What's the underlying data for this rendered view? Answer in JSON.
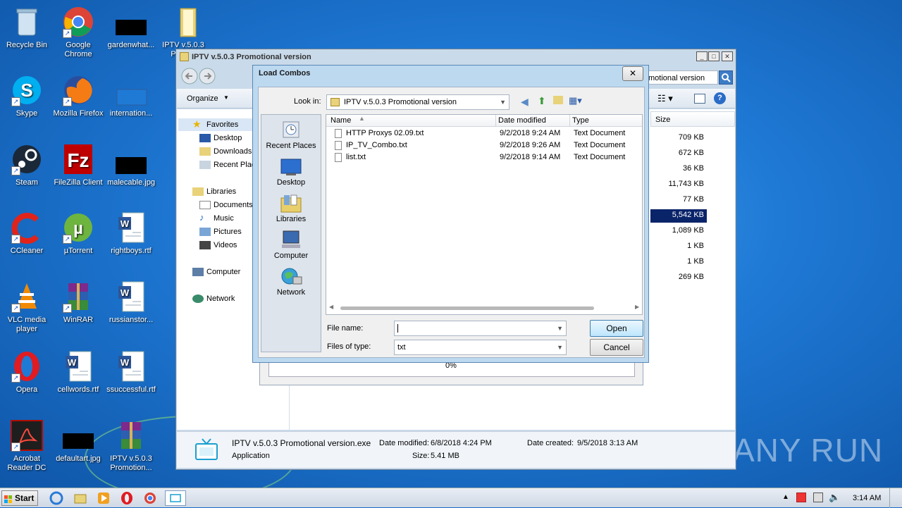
{
  "desktop": {
    "icons": [
      {
        "label": "Recycle Bin"
      },
      {
        "label": "Google Chrome"
      },
      {
        "label": "gardenwhat..."
      },
      {
        "label": "IPTV v.5.0.3 Prom..."
      },
      {
        "label": "Skype"
      },
      {
        "label": "Mozilla Firefox"
      },
      {
        "label": "internation..."
      },
      {
        "label": "Steam"
      },
      {
        "label": "FileZilla Client"
      },
      {
        "label": "malecable.jpg"
      },
      {
        "label": "CCleaner"
      },
      {
        "label": "µTorrent"
      },
      {
        "label": "rightboys.rtf"
      },
      {
        "label": "VLC media player"
      },
      {
        "label": "WinRAR"
      },
      {
        "label": "russianstor..."
      },
      {
        "label": "Opera"
      },
      {
        "label": "cellwords.rtf"
      },
      {
        "label": "ssuccessful.rtf"
      },
      {
        "label": "Acrobat Reader DC"
      },
      {
        "label": "defaultart.jpg"
      },
      {
        "label": "IPTV v.5.0.3 Promotion..."
      }
    ],
    "watermark": "ANY RUN"
  },
  "explorer": {
    "title": "IPTV v.5.0.3 Promotional version",
    "address_tail": "motional version",
    "toolbar_organize": "Organize",
    "nav": {
      "favorites": "Favorites",
      "desktop": "Desktop",
      "downloads": "Downloads",
      "recent": "Recent Plac",
      "libraries": "Libraries",
      "documents": "Documents",
      "music": "Music",
      "pictures": "Pictures",
      "videos": "Videos",
      "computer": "Computer",
      "network": "Network"
    },
    "size_header": "Size",
    "sizes": [
      "709 KB",
      "672 KB",
      "36 KB",
      "11,743 KB",
      "77 KB",
      "5,542 KB",
      "1,089 KB",
      "1 KB",
      "1 KB",
      "269 KB"
    ],
    "details": {
      "name": "IPTV v.5.0.3 Promotional version.exe",
      "type": "Application",
      "date_modified_label": "Date modified:",
      "date_modified": "6/8/2018 4:24 PM",
      "size_label": "Size:",
      "size": "5.41 MB",
      "date_created_label": "Date created:",
      "date_created": "9/5/2018 3:13 AM"
    }
  },
  "background_progress": {
    "text": "0%"
  },
  "dialog": {
    "title": "Load Combos",
    "look_in_label": "Look in:",
    "look_in_value": "IPTV v.5.0.3 Promotional version",
    "places": [
      {
        "label": "Recent Places"
      },
      {
        "label": "Desktop"
      },
      {
        "label": "Libraries"
      },
      {
        "label": "Computer"
      },
      {
        "label": "Network"
      }
    ],
    "columns": {
      "name": "Name",
      "date": "Date modified",
      "type": "Type"
    },
    "files": [
      {
        "name": "HTTP Proxys 02.09.txt",
        "date": "9/2/2018 9:24 AM",
        "type": "Text Document"
      },
      {
        "name": "IP_TV_Combo.txt",
        "date": "9/2/2018 9:26 AM",
        "type": "Text Document"
      },
      {
        "name": "list.txt",
        "date": "9/2/2018 9:14 AM",
        "type": "Text Document"
      }
    ],
    "file_name_label": "File name:",
    "file_name_value": "",
    "file_type_label": "Files of type:",
    "file_type_value": "txt",
    "open_label": "Open",
    "cancel_label": "Cancel"
  },
  "taskbar": {
    "start_label": "Start",
    "clock": "3:14 AM"
  }
}
